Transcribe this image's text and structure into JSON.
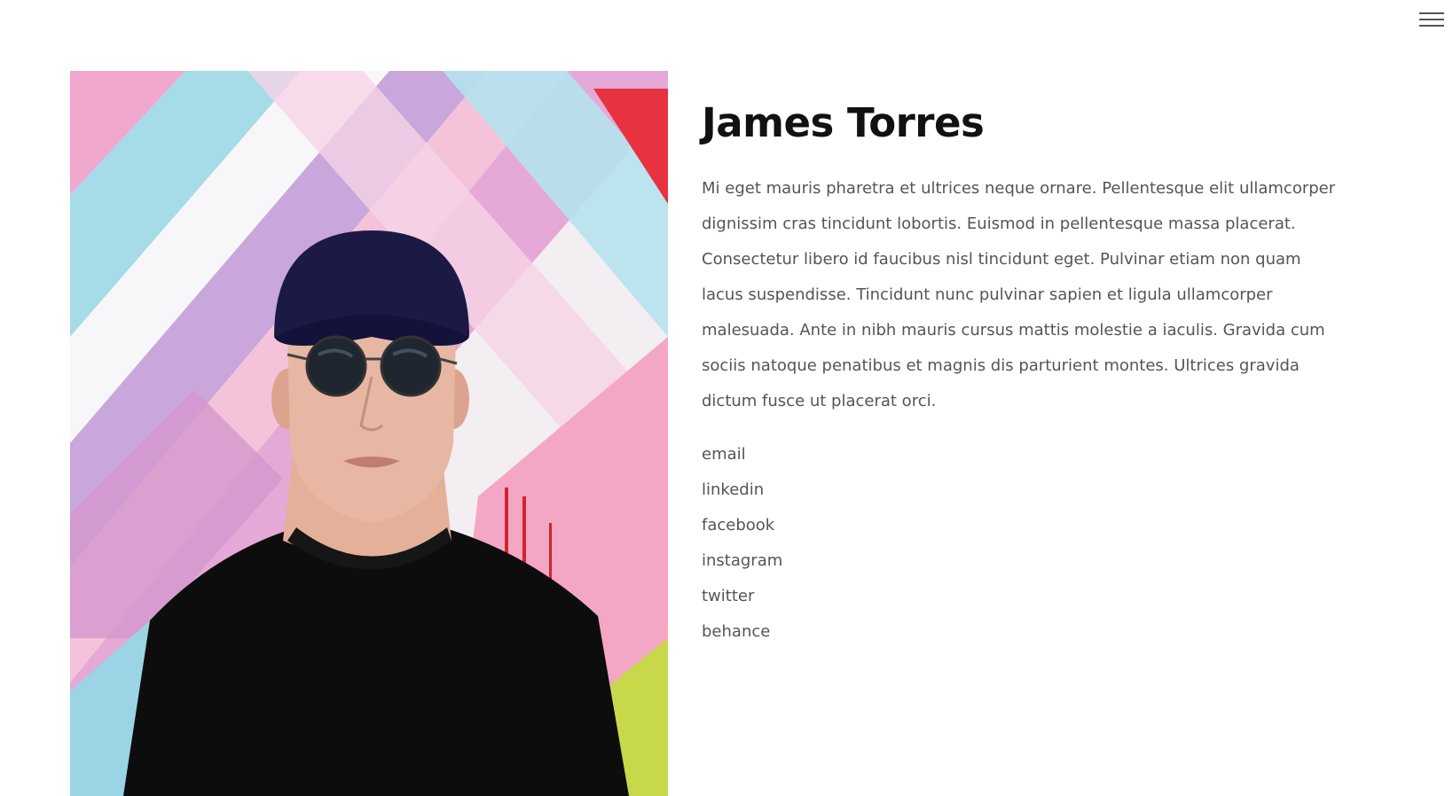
{
  "profile": {
    "name": "James Torres",
    "bio": "Mi eget mauris pharetra et ultrices neque ornare. Pellentesque elit ullamcorper dignissim cras tincidunt lobortis. Euismod in pellentesque massa placerat. Consectetur libero id faucibus nisl tincidunt eget. Pulvinar etiam non quam lacus suspendisse. Tincidunt nunc pulvinar sapien et ligula ullamcorper malesuada. Ante in nibh mauris cursus mattis molestie a iaculis. Gravida cum sociis natoque penatibus et magnis dis parturient montes. Ultrices gravida dictum fusce ut placerat orci."
  },
  "social_links": [
    {
      "label": "email"
    },
    {
      "label": "linkedin"
    },
    {
      "label": "facebook"
    },
    {
      "label": "instagram"
    },
    {
      "label": "twitter"
    },
    {
      "label": "behance"
    }
  ],
  "header": {
    "menu_icon": "hamburger-menu-icon"
  },
  "colors": {
    "text_dark": "#111111",
    "text_body": "#555555",
    "background": "#ffffff"
  }
}
